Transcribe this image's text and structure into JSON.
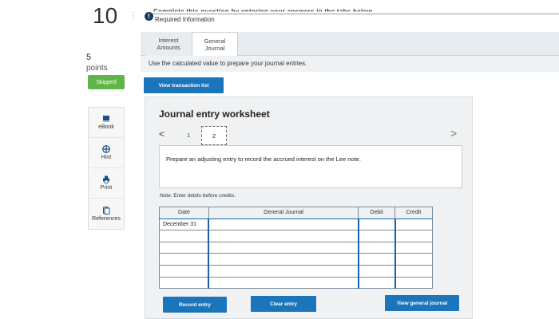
{
  "question": {
    "number": "10",
    "menu_glyph": "⋮",
    "points_value": "5",
    "points_label": "points",
    "status": "Skipped"
  },
  "tools": [
    {
      "icon": "ebook-icon",
      "label": "eBook"
    },
    {
      "icon": "hint-icon",
      "label": "Hint"
    },
    {
      "icon": "print-icon",
      "label": "Print"
    },
    {
      "icon": "references-icon",
      "label": "References"
    }
  ],
  "header": {
    "instruction_line": "Complete this question by entering your answers in the tabs below.",
    "required_info": "Required Information"
  },
  "tabs": [
    {
      "line1": "Interest",
      "line2": "Amounts"
    },
    {
      "line1": "General",
      "line2": "Journal"
    }
  ],
  "instruction": "Use the calculated value to prepare your journal entries.",
  "buttons": {
    "view_transaction": "View transaction list",
    "record_entry": "Record entry",
    "clear_entry": "Clear entry",
    "view_general_journal": "View general journal"
  },
  "worksheet": {
    "title": "Journal entry worksheet",
    "prev": "<",
    "next": ">",
    "pages": [
      "1",
      "2"
    ],
    "prompt": "Prepare an adjusting entry to record the accrued interest on the Lee note.",
    "note": "Note: Enter debits before credits."
  },
  "journal": {
    "headers": [
      "Date",
      "General Journal",
      "Debit",
      "Credit"
    ],
    "rows": [
      [
        "December 31",
        "",
        "",
        ""
      ],
      [
        "",
        "",
        "",
        ""
      ],
      [
        "",
        "",
        "",
        ""
      ],
      [
        "",
        "",
        "",
        ""
      ],
      [
        "",
        "",
        "",
        ""
      ],
      [
        "",
        "",
        "",
        ""
      ]
    ]
  },
  "colors": {
    "button_blue": "#1b75bb",
    "skipped_green": "#5fb548",
    "info_navy": "#1a3a5c"
  }
}
